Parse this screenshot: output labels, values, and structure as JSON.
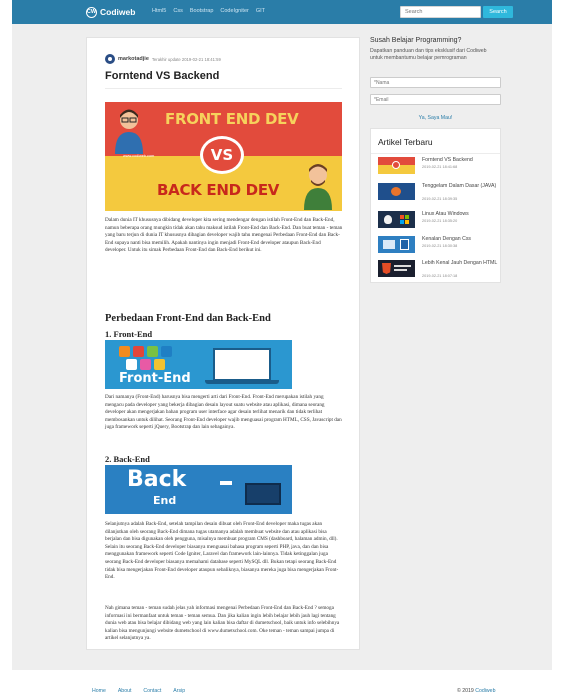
{
  "navbar": {
    "brand": "Codiweb",
    "brand_logo": "CW",
    "links": [
      "Html5",
      "Css",
      "Bootstrap",
      "CodeIgniter",
      "GIT"
    ],
    "search_placeholder": "Search",
    "search_button": "Search"
  },
  "article": {
    "author": "markotadjie",
    "updated": "Terakhir update 2019-02-21 18:41:59",
    "title": "Forntend VS Backend",
    "hero": {
      "top_text": "FRONT END DEV",
      "vs_text": "VS",
      "url_text": "www.codiweb.com",
      "bottom_text": "BACK END DEV"
    },
    "intro": "Dalam dunia IT khususnya dibidang developer kita sering mendengar dengan istilah Front-End dan Back-End, namun beberapa orang mungkin tidak akan tahu maksud istilah Front-End dan Back-End. Dan buat teman - teman yang baru terjun di dunia IT khususnya dibagian developer wajib tahu mengenai Perbedaan Front-End dan Back-End supaya nanti bisa memilih. Apakah nantinya ingin menjadi Front-End developer ataupun Back-End developer. Untuk itu simak Perbedaan Front-End dan Back-End berikut ini.",
    "section_heading": "Perbedaan Front-End dan Back-End",
    "front_heading": "1. Front-End",
    "front_image_label": "Front-End",
    "front_paragraph": "Dari namanya (Front-End) harusnya bisa mengerti arti dari Front-End. Front-End merupakan istilah yang mengacu pada developer yang bekerja dibagian desain layout suatu website atau aplikasi, dimana seorang developer akan mengerjakan bahan program user interface agar desain terlihat menarik dan tidak terlihat membosankan untuk dilihat. Seorang Front-End developer wajib menguasai program HTML, CSS, Javascript dan juga framework seperti jQuery, Bootstrap dan lain sebagainya.",
    "back_heading": "2. Back-End",
    "back_image_word1": "Back",
    "back_image_word2": "End",
    "back_paragraph": "Selanjutnya adalah Back-End, setelah tampilan desain dibuat oleh Front-End developer maka tugas akan dilanjutkan oleh seorang Back-End dimana tugas utamanya adalah membuat website dan atau aplikasi bisa berjalan dan bisa digunakan oleh pengguna, misalnya membuat program CMS (dashboard, halaman admin, dll). Selain itu seorang Back-End developer biasanya menguasai bahasa program seperti PHP, java, dan dan bisa menggunakan framework seperti Code Igniter, Laravel dan framework lain-lainnya. Tidak ketinggalan juga seorang Back-End developer biasanya memahami database seperti MySQL dll. Bukan tetapi seorang Back-End tidak bisa mengerjakan Front-End developer ataupun sebaliknya, biasanya mereka juga bisa mengerjakan Front-End.",
    "closing_paragraph": "Nah gimana teman - teman sudah jelas yah informasi mengenai Perbedaan Front-End dan Back-End ? semoga informasi ini bermanfaat untuk teman - teman semua. Dan jika kalian ingin lebih belajar lebih jauh lagi tentang dunia web atau bisa belajar dibidang web yang lain kalian bisa daftar di dumetschool, baik untuk info selebihnya kalian bisa mengunjungi website dumetschool di www.dumetschool.com. Oke teman - teman sampai jumpa di artikel selanjutnya ya."
  },
  "sidebar": {
    "subscribe_title": "Susah Belajar Programming?",
    "subscribe_desc": "Dapatkan panduan dan tips eksklusif dari Codiweb untuk membantumu belajar pemrograman",
    "name_placeholder": "*Nama",
    "email_placeholder": "*Email",
    "submit_label": "Ya, Saya Mau!",
    "recent_title": "Artikel Terbaru",
    "recent": [
      {
        "title": "Forntend VS Backend",
        "date": "2019-02-21 18:41:68",
        "thumb": "frontend-vs-backend"
      },
      {
        "title": "Tenggelam Dalam Dasar (JAVA)",
        "date": "2019-02-21 18:39:35",
        "thumb": "java"
      },
      {
        "title": "Linux Atau Windows",
        "date": "2019-02-21 18:35:20",
        "thumb": "linux-windows"
      },
      {
        "title": "Kenalan Dengan Css",
        "date": "2019-02-21 18:30:38",
        "thumb": "css"
      },
      {
        "title": "Lebih Kenal Jauh Dengan HTML",
        "date": "2019-02-21 18:07:18",
        "thumb": "html5"
      }
    ]
  },
  "footer": {
    "links": [
      "Home",
      "About",
      "Contact",
      "Arsip"
    ],
    "copyright": "© 2019",
    "copyright_brand": "Codiweb"
  },
  "colors": {
    "navbar": "#2a7da8",
    "search_button": "#2fb8dc",
    "page_bg": "#eeeeee",
    "hero_red": "#e24b3c",
    "hero_yellow": "#f4c93e"
  }
}
